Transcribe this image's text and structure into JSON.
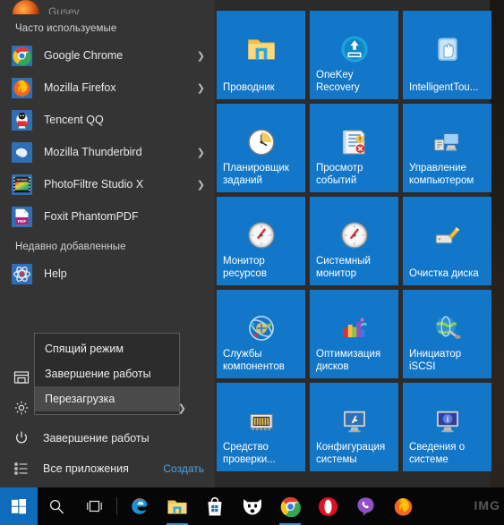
{
  "user": {
    "name": "Gusev"
  },
  "sections": {
    "frequent_title": "Часто используемые",
    "recent_title": "Недавно добавленные"
  },
  "frequent_apps": [
    {
      "label": "Google Chrome",
      "icon": "chrome-icon",
      "has_chevron": true
    },
    {
      "label": "Mozilla Firefox",
      "icon": "firefox-icon",
      "has_chevron": true
    },
    {
      "label": "Tencent QQ",
      "icon": "tencent-qq-icon",
      "has_chevron": false
    },
    {
      "label": "Mozilla Thunderbird",
      "icon": "thunderbird-icon",
      "has_chevron": true
    },
    {
      "label": "PhotoFiltre Studio X",
      "icon": "photofiltre-icon",
      "has_chevron": true
    },
    {
      "label": "Foxit PhantomPDF",
      "icon": "foxit-pdf-icon",
      "has_chevron": false
    }
  ],
  "recent_apps": [
    {
      "label": "Help",
      "icon": "help-atom-icon",
      "has_chevron": false
    }
  ],
  "bottom_items": [
    {
      "label": "",
      "icon": "file-explorer-icon",
      "chevron": false
    },
    {
      "label": "",
      "icon": "settings-gear-icon",
      "chevron": false
    },
    {
      "label": "Завершение работы",
      "icon": "power-icon",
      "chevron": false
    },
    {
      "label": "Все приложения",
      "icon": "all-apps-icon",
      "chevron": false,
      "extra_link": "Создать"
    }
  ],
  "context_menu": {
    "items": [
      {
        "label": "Спящий режим",
        "selected": false
      },
      {
        "label": "Завершение работы",
        "selected": false
      },
      {
        "label": "Перезагрузка",
        "selected": true
      }
    ]
  },
  "tiles": [
    {
      "label": "Проводник",
      "icon": "folder-icon"
    },
    {
      "label": "OneKey Recovery",
      "icon": "onekey-recovery-icon"
    },
    {
      "label": "IntelligentTou...",
      "icon": "intelligent-touchpad-icon"
    },
    {
      "label": "Планировщик заданий",
      "icon": "task-scheduler-clock-icon"
    },
    {
      "label": "Просмотр событий",
      "icon": "event-viewer-icon"
    },
    {
      "label": "Управление компьютером",
      "icon": "computer-management-icon"
    },
    {
      "label": "Монитор ресурсов",
      "icon": "resource-monitor-gauge-icon"
    },
    {
      "label": "Системный монитор",
      "icon": "performance-monitor-gauge-icon"
    },
    {
      "label": "Очистка диска",
      "icon": "disk-cleanup-brush-icon"
    },
    {
      "label": "Службы компонентов",
      "icon": "component-services-icon"
    },
    {
      "label": "Оптимизация дисков",
      "icon": "defragment-icon"
    },
    {
      "label": "Инициатор iSCSI",
      "icon": "iscsi-globe-icon"
    },
    {
      "label": "Средство проверки...",
      "icon": "memory-chip-icon"
    },
    {
      "label": "Конфигурация системы",
      "icon": "msconfig-monitor-icon"
    },
    {
      "label": "Сведения о системе",
      "icon": "system-info-monitor-icon"
    }
  ],
  "taskbar": {
    "buttons": [
      {
        "name": "start-button",
        "icon": "windows-logo-icon",
        "active": false
      },
      {
        "name": "search-button",
        "icon": "search-icon",
        "active": false
      },
      {
        "name": "task-view-button",
        "icon": "task-view-icon",
        "active": false
      },
      {
        "name": "edge-button",
        "icon": "edge-icon",
        "active": false
      },
      {
        "name": "explorer-button",
        "icon": "folder-icon",
        "active": true
      },
      {
        "name": "store-button",
        "icon": "store-bag-icon",
        "active": false
      },
      {
        "name": "aimp-button",
        "icon": "aimp-fox-icon",
        "active": false
      },
      {
        "name": "chrome-button",
        "icon": "chrome-icon",
        "active": true
      },
      {
        "name": "opera-button",
        "icon": "opera-icon",
        "active": false
      },
      {
        "name": "viber-button",
        "icon": "viber-icon",
        "active": false
      },
      {
        "name": "firefox-button",
        "icon": "firefox-icon",
        "active": false
      }
    ]
  },
  "watermark": "IMG",
  "colors": {
    "tile_blue": "#1277c9",
    "menu_gray": "#343434",
    "tile_pane_gray": "#2b2b2b",
    "accent_link": "#4aa3e8",
    "taskbar_black": "#060606",
    "start_button_blue": "#0f6cbd"
  }
}
